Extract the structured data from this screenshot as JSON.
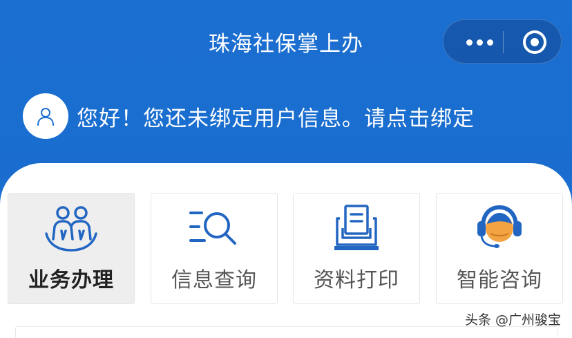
{
  "header": {
    "title": "珠海社保掌上办",
    "greeting": "您好！您还未绑定用户信息。请点击绑定"
  },
  "capsule": {
    "more_icon": "more-dots-icon",
    "close_icon": "miniprogram-close-icon"
  },
  "menu": {
    "items": [
      {
        "label": "业务办理",
        "icon": "business-people-icon",
        "active": true
      },
      {
        "label": "信息查询",
        "icon": "search-list-icon",
        "active": false
      },
      {
        "label": "资料打印",
        "icon": "printer-icon",
        "active": false
      },
      {
        "label": "智能咨询",
        "icon": "customer-service-headset-icon",
        "active": false
      }
    ]
  },
  "watermark": "头条 @广州骏宝",
  "colors": {
    "brand_blue": "#1a6fd0",
    "icon_blue": "#2266c2",
    "headset_orange": "#f3a341"
  }
}
